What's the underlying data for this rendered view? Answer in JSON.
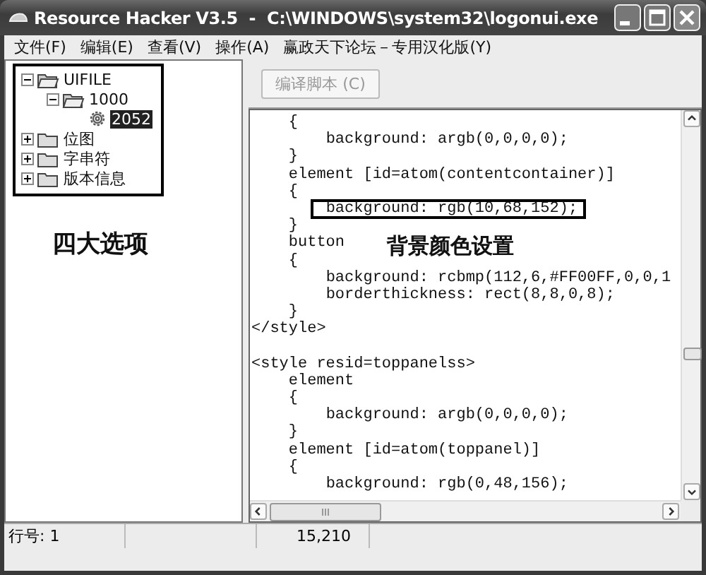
{
  "window": {
    "title": "Resource Hacker V3.5  -  C:\\WINDOWS\\system32\\logonui.exe"
  },
  "menu": [
    "文件(F)",
    "编辑(E)",
    "查看(V)",
    "操作(A)",
    "赢政天下论坛－专用汉化版(Y)"
  ],
  "tree": [
    {
      "label": "UIFILE",
      "kind": "folder",
      "expanded": true,
      "selected": false,
      "children": [
        {
          "label": "1000",
          "kind": "folder",
          "expanded": true,
          "selected": false,
          "children": [
            {
              "label": "2052",
              "kind": "resource",
              "selected": true
            }
          ]
        }
      ]
    },
    {
      "label": "位图",
      "kind": "folder",
      "expanded": false,
      "selected": false
    },
    {
      "label": "字串符",
      "kind": "folder",
      "expanded": false,
      "selected": false
    },
    {
      "label": "版本信息",
      "kind": "folder",
      "expanded": false,
      "selected": false
    }
  ],
  "tree_note": "四大选项",
  "toolbar": {
    "button": {
      "label": "编译脚本 (C)",
      "disabled": true
    }
  },
  "code_lines": [
    {
      "text": "    {",
      "boxed": false
    },
    {
      "text": "        background: argb(0,0,0,0);",
      "boxed": false
    },
    {
      "text": "    }",
      "boxed": false
    },
    {
      "text": "    element [id=atom(contentcontainer)]",
      "boxed": false
    },
    {
      "text": "    {",
      "boxed": false
    },
    {
      "text": "        background: rgb(10,68,152);",
      "boxed": true
    },
    {
      "text": "    }",
      "boxed": false
    },
    {
      "text": "    button",
      "boxed": false,
      "note": "背景颜色设置"
    },
    {
      "text": "    {",
      "boxed": false
    },
    {
      "text": "        background: rcbmp(112,6,#FF00FF,0,0,1",
      "boxed": false
    },
    {
      "text": "        borderthickness: rect(8,8,0,8);",
      "boxed": false
    },
    {
      "text": "    }",
      "boxed": false
    },
    {
      "text": "</style>",
      "boxed": false
    },
    {
      "boxed": false
    },
    {
      "text": "<style resid=toppanelss>",
      "boxed": false
    },
    {
      "text": "    element",
      "boxed": false
    },
    {
      "text": "    {",
      "boxed": false
    },
    {
      "text": "        background: argb(0,0,0,0);",
      "boxed": false
    },
    {
      "text": "    }",
      "boxed": false
    },
    {
      "text": "    element [id=atom(toppanel)]",
      "boxed": false
    },
    {
      "text": "    {",
      "boxed": false
    },
    {
      "text": "        background: rgb(0,48,156);",
      "boxed": false
    }
  ],
  "status_bar": [
    "行号: 1",
    "15,210"
  ]
}
